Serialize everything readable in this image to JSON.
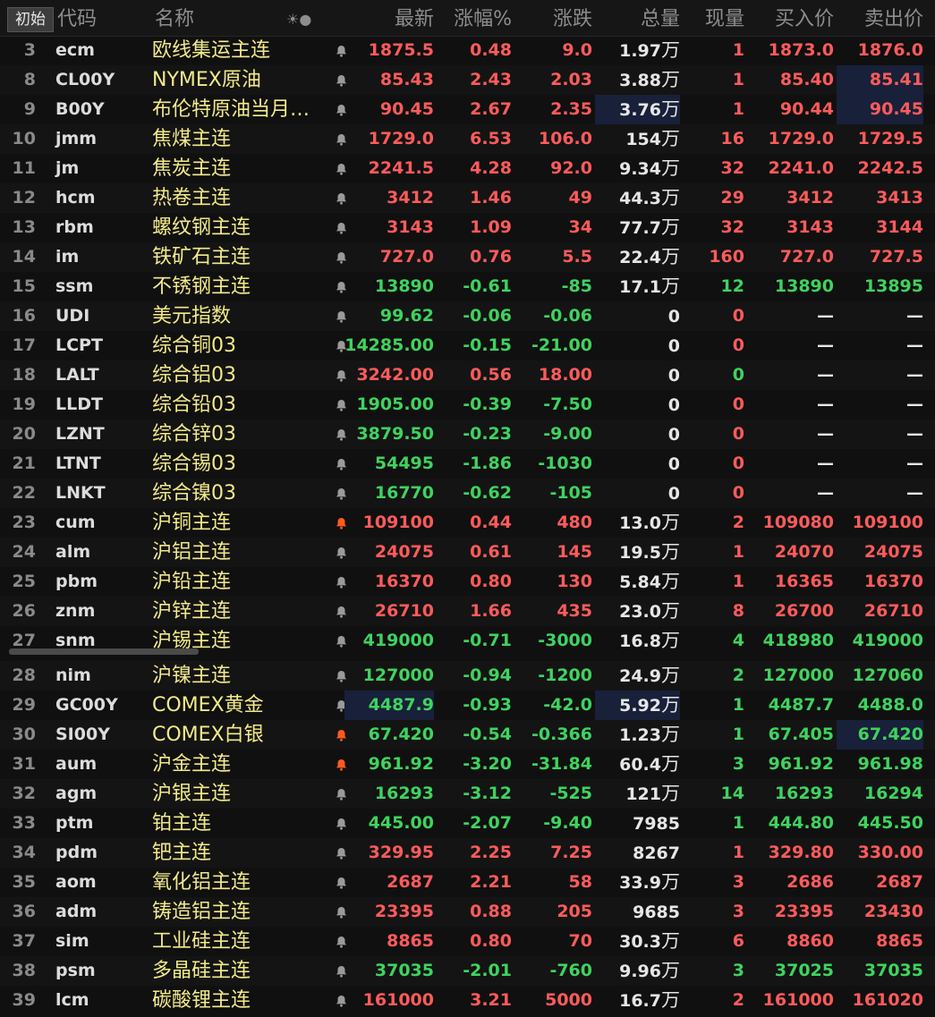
{
  "header": {
    "tab_label": "初始",
    "columns": {
      "code": "代码",
      "name": "名称",
      "icons": "☀●",
      "last": "最新",
      "pct": "涨幅%",
      "chg": "涨跌",
      "vol": "总量",
      "cur": "现量",
      "bid": "买入价",
      "ask": "卖出价"
    }
  },
  "colors": {
    "up": "#ff5b5b",
    "down": "#3fd35e",
    "name": "#f2ea8a",
    "bell_active": "#ff5a1f",
    "bell_idle": "#9a9a9a"
  },
  "rows": [
    {
      "num": "3",
      "code": "ecm",
      "name": "欧线集运主连",
      "bell": "idle",
      "last": "1875.5",
      "pct": "0.48",
      "chg": "9.0",
      "vol": "1.97",
      "unit": "万",
      "cur": "1",
      "bid": "1873.0",
      "ask": "1876.0",
      "dir": "up"
    },
    {
      "num": "8",
      "code": "CL00Y",
      "name": "NYMEX原油",
      "bell": "idle",
      "last": "85.43",
      "pct": "2.43",
      "chg": "2.03",
      "vol": "3.88",
      "unit": "万",
      "cur": "1",
      "bid": "85.40",
      "ask": "85.41",
      "dir": "up"
    },
    {
      "num": "9",
      "code": "B00Y",
      "name": "布伦特原油当月…",
      "bell": "idle",
      "last": "90.45",
      "pct": "2.67",
      "chg": "2.35",
      "vol": "3.76",
      "unit": "万",
      "cur": "1",
      "bid": "90.44",
      "ask": "90.45",
      "dir": "up"
    },
    {
      "num": "10",
      "code": "jmm",
      "name": "焦煤主连",
      "bell": "idle",
      "last": "1729.0",
      "pct": "6.53",
      "chg": "106.0",
      "vol": "154",
      "unit": "万",
      "cur": "16",
      "bid": "1729.0",
      "ask": "1729.5",
      "dir": "up"
    },
    {
      "num": "11",
      "code": "jm",
      "name": "焦炭主连",
      "bell": "idle",
      "last": "2241.5",
      "pct": "4.28",
      "chg": "92.0",
      "vol": "9.34",
      "unit": "万",
      "cur": "32",
      "bid": "2241.0",
      "ask": "2242.5",
      "dir": "up"
    },
    {
      "num": "12",
      "code": "hcm",
      "name": "热卷主连",
      "bell": "idle",
      "last": "3412",
      "pct": "1.46",
      "chg": "49",
      "vol": "44.3",
      "unit": "万",
      "cur": "29",
      "bid": "3412",
      "ask": "3413",
      "dir": "up"
    },
    {
      "num": "13",
      "code": "rbm",
      "name": "螺纹钢主连",
      "bell": "idle",
      "last": "3143",
      "pct": "1.09",
      "chg": "34",
      "vol": "77.7",
      "unit": "万",
      "cur": "32",
      "bid": "3143",
      "ask": "3144",
      "dir": "up"
    },
    {
      "num": "14",
      "code": "im",
      "name": "铁矿石主连",
      "bell": "idle",
      "last": "727.0",
      "pct": "0.76",
      "chg": "5.5",
      "vol": "22.4",
      "unit": "万",
      "cur": "160",
      "bid": "727.0",
      "ask": "727.5",
      "dir": "up"
    },
    {
      "num": "15",
      "code": "ssm",
      "name": "不锈钢主连",
      "bell": "idle",
      "last": "13890",
      "pct": "-0.61",
      "chg": "-85",
      "vol": "17.1",
      "unit": "万",
      "cur": "12",
      "bid": "13890",
      "ask": "13895",
      "dir": "dn"
    },
    {
      "num": "16",
      "code": "UDI",
      "name": "美元指数",
      "bell": "idle",
      "last": "99.62",
      "pct": "-0.06",
      "chg": "-0.06",
      "vol": "0",
      "unit": "",
      "cur": "0",
      "bid": "—",
      "ask": "—",
      "dir": "dn"
    },
    {
      "num": "17",
      "code": "LCPT",
      "name": "综合铜03",
      "bell": "idle",
      "last": "14285.00",
      "pct": "-0.15",
      "chg": "-21.00",
      "vol": "0",
      "unit": "",
      "cur": "0",
      "bid": "—",
      "ask": "—",
      "dir": "dn"
    },
    {
      "num": "18",
      "code": "LALT",
      "name": "综合铝03",
      "bell": "idle",
      "last": "3242.00",
      "pct": "0.56",
      "chg": "18.00",
      "vol": "0",
      "unit": "",
      "cur": "0",
      "bid": "—",
      "ask": "—",
      "dir": "up"
    },
    {
      "num": "19",
      "code": "LLDT",
      "name": "综合铅03",
      "bell": "idle",
      "last": "1905.00",
      "pct": "-0.39",
      "chg": "-7.50",
      "vol": "0",
      "unit": "",
      "cur": "0",
      "bid": "—",
      "ask": "—",
      "dir": "dn"
    },
    {
      "num": "20",
      "code": "LZNT",
      "name": "综合锌03",
      "bell": "idle",
      "last": "3879.50",
      "pct": "-0.23",
      "chg": "-9.00",
      "vol": "0",
      "unit": "",
      "cur": "0",
      "bid": "—",
      "ask": "—",
      "dir": "dn"
    },
    {
      "num": "21",
      "code": "LTNT",
      "name": "综合锡03",
      "bell": "idle",
      "last": "54495",
      "pct": "-1.86",
      "chg": "-1030",
      "vol": "0",
      "unit": "",
      "cur": "0",
      "bid": "—",
      "ask": "—",
      "dir": "dn"
    },
    {
      "num": "22",
      "code": "LNKT",
      "name": "综合镍03",
      "bell": "idle",
      "last": "16770",
      "pct": "-0.62",
      "chg": "-105",
      "vol": "0",
      "unit": "",
      "cur": "0",
      "bid": "—",
      "ask": "—",
      "dir": "dn"
    },
    {
      "num": "23",
      "code": "cum",
      "name": "沪铜主连",
      "bell": "active",
      "last": "109100",
      "pct": "0.44",
      "chg": "480",
      "vol": "13.0",
      "unit": "万",
      "cur": "2",
      "bid": "109080",
      "ask": "109100",
      "dir": "up"
    },
    {
      "num": "24",
      "code": "alm",
      "name": "沪铝主连",
      "bell": "idle",
      "last": "24075",
      "pct": "0.61",
      "chg": "145",
      "vol": "19.5",
      "unit": "万",
      "cur": "1",
      "bid": "24070",
      "ask": "24075",
      "dir": "up"
    },
    {
      "num": "25",
      "code": "pbm",
      "name": "沪铅主连",
      "bell": "idle",
      "last": "16370",
      "pct": "0.80",
      "chg": "130",
      "vol": "5.84",
      "unit": "万",
      "cur": "1",
      "bid": "16365",
      "ask": "16370",
      "dir": "up"
    },
    {
      "num": "26",
      "code": "znm",
      "name": "沪锌主连",
      "bell": "idle",
      "last": "26710",
      "pct": "1.66",
      "chg": "435",
      "vol": "23.0",
      "unit": "万",
      "cur": "8",
      "bid": "26700",
      "ask": "26710",
      "dir": "up"
    },
    {
      "num": "27",
      "code": "snm",
      "name": "沪锡主连",
      "bell": "idle",
      "last": "419000",
      "pct": "-0.71",
      "chg": "-3000",
      "vol": "16.8",
      "unit": "万",
      "cur": "4",
      "bid": "418980",
      "ask": "419000",
      "dir": "dn"
    },
    {
      "num": "28",
      "code": "nim",
      "name": "沪镍主连",
      "bell": "idle",
      "last": "127000",
      "pct": "-0.94",
      "chg": "-1200",
      "vol": "24.9",
      "unit": "万",
      "cur": "2",
      "bid": "127000",
      "ask": "127060",
      "dir": "dn"
    },
    {
      "num": "29",
      "code": "GC00Y",
      "name": "COMEX黄金",
      "bell": "idle",
      "last": "4487.9",
      "pct": "-0.93",
      "chg": "-42.0",
      "vol": "5.92",
      "unit": "万",
      "cur": "1",
      "bid": "4487.7",
      "ask": "4488.0",
      "dir": "dn"
    },
    {
      "num": "30",
      "code": "SI00Y",
      "name": "COMEX白银",
      "bell": "active",
      "last": "67.420",
      "pct": "-0.54",
      "chg": "-0.366",
      "vol": "1.23",
      "unit": "万",
      "cur": "1",
      "bid": "67.405",
      "ask": "67.420",
      "dir": "dn"
    },
    {
      "num": "31",
      "code": "aum",
      "name": "沪金主连",
      "bell": "active",
      "last": "961.92",
      "pct": "-3.20",
      "chg": "-31.84",
      "vol": "60.4",
      "unit": "万",
      "cur": "3",
      "bid": "961.92",
      "ask": "961.98",
      "dir": "dn"
    },
    {
      "num": "32",
      "code": "agm",
      "name": "沪银主连",
      "bell": "idle",
      "last": "16293",
      "pct": "-3.12",
      "chg": "-525",
      "vol": "121",
      "unit": "万",
      "cur": "14",
      "bid": "16293",
      "ask": "16294",
      "dir": "dn"
    },
    {
      "num": "33",
      "code": "ptm",
      "name": "铂主连",
      "bell": "idle",
      "last": "445.00",
      "pct": "-2.07",
      "chg": "-9.40",
      "vol": "7985",
      "unit": "",
      "cur": "1",
      "bid": "444.80",
      "ask": "445.50",
      "dir": "dn"
    },
    {
      "num": "34",
      "code": "pdm",
      "name": "钯主连",
      "bell": "idle",
      "last": "329.95",
      "pct": "2.25",
      "chg": "7.25",
      "vol": "8267",
      "unit": "",
      "cur": "1",
      "bid": "329.80",
      "ask": "330.00",
      "dir": "up"
    },
    {
      "num": "35",
      "code": "aom",
      "name": "氧化铝主连",
      "bell": "idle",
      "last": "2687",
      "pct": "2.21",
      "chg": "58",
      "vol": "33.9",
      "unit": "万",
      "cur": "3",
      "bid": "2686",
      "ask": "2687",
      "dir": "up"
    },
    {
      "num": "36",
      "code": "adm",
      "name": "铸造铝主连",
      "bell": "idle",
      "last": "23395",
      "pct": "0.88",
      "chg": "205",
      "vol": "9685",
      "unit": "",
      "cur": "3",
      "bid": "23395",
      "ask": "23430",
      "dir": "up"
    },
    {
      "num": "37",
      "code": "sim",
      "name": "工业硅主连",
      "bell": "idle",
      "last": "8865",
      "pct": "0.80",
      "chg": "70",
      "vol": "30.3",
      "unit": "万",
      "cur": "6",
      "bid": "8860",
      "ask": "8865",
      "dir": "up"
    },
    {
      "num": "38",
      "code": "psm",
      "name": "多晶硅主连",
      "bell": "idle",
      "last": "37035",
      "pct": "-2.01",
      "chg": "-760",
      "vol": "9.96",
      "unit": "万",
      "cur": "3",
      "bid": "37025",
      "ask": "37035",
      "dir": "dn"
    },
    {
      "num": "39",
      "code": "lcm",
      "name": "碳酸锂主连",
      "bell": "idle",
      "last": "161000",
      "pct": "3.21",
      "chg": "5000",
      "vol": "16.7",
      "unit": "万",
      "cur": "2",
      "bid": "161000",
      "ask": "161020",
      "dir": "up"
    }
  ]
}
